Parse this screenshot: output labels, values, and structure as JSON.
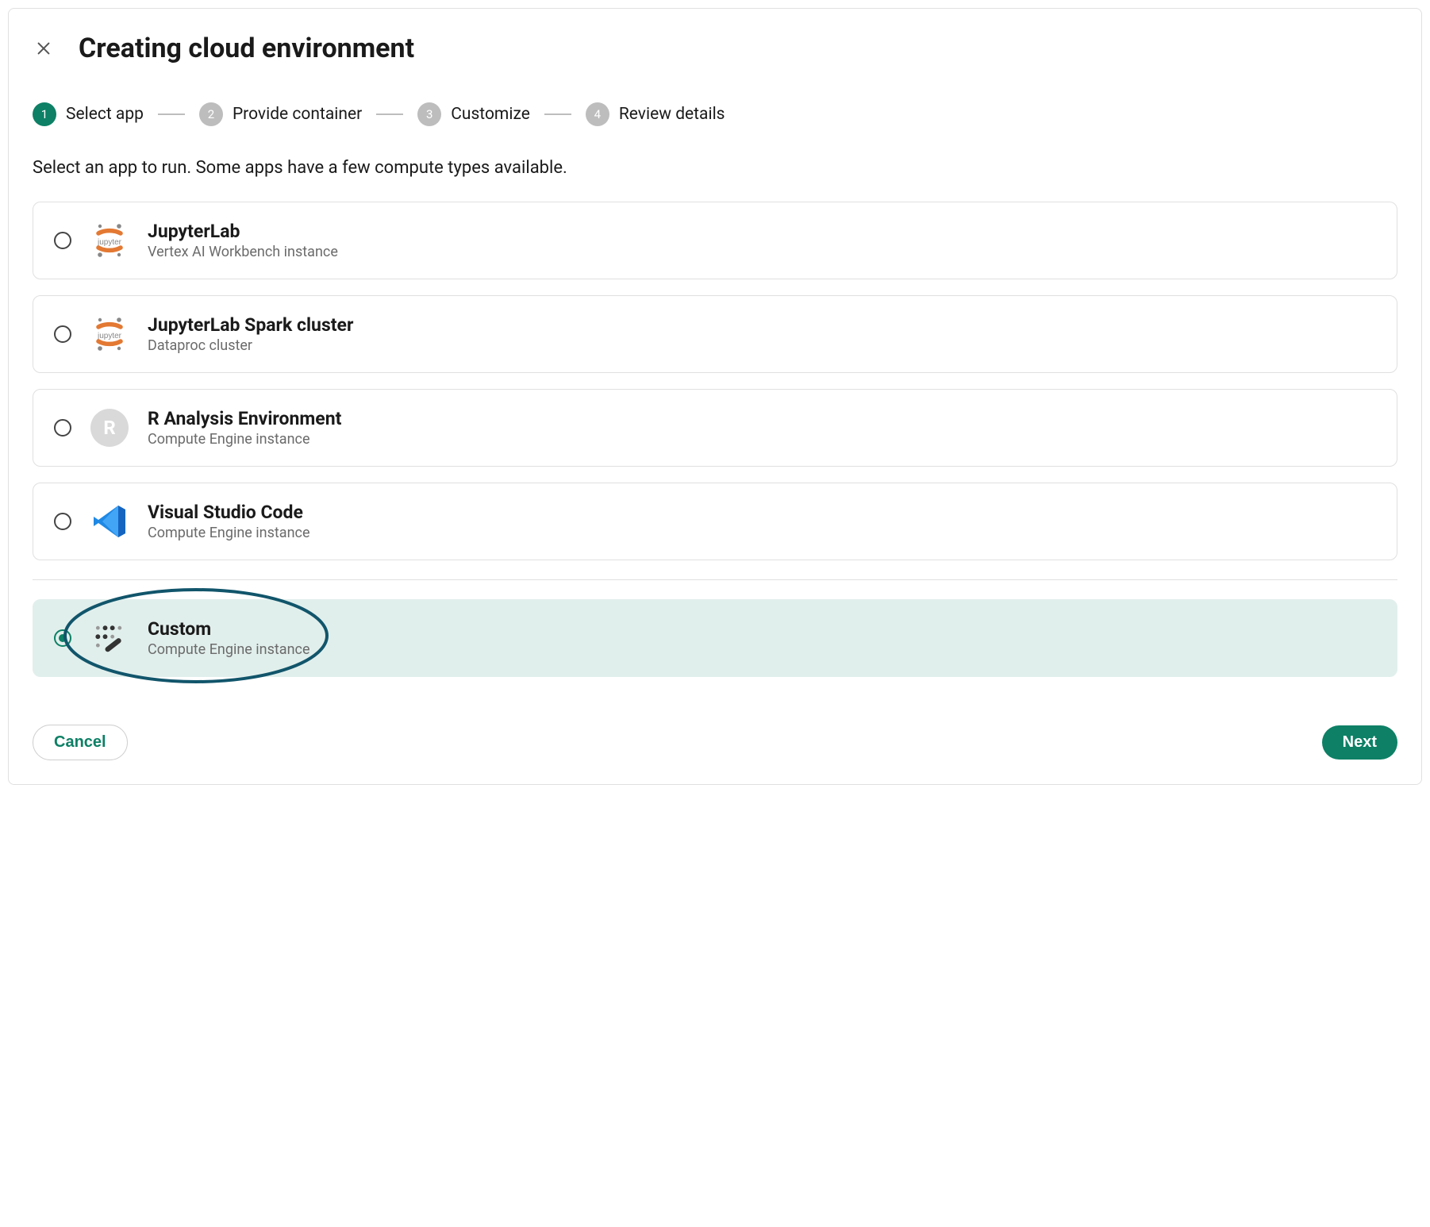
{
  "header": {
    "title": "Creating cloud environment"
  },
  "stepper": {
    "steps": [
      {
        "num": "1",
        "label": "Select app",
        "active": true
      },
      {
        "num": "2",
        "label": "Provide container",
        "active": false
      },
      {
        "num": "3",
        "label": "Customize",
        "active": false
      },
      {
        "num": "4",
        "label": "Review details",
        "active": false
      }
    ]
  },
  "instruction": "Select an app to run. Some apps have a few compute types available.",
  "options": [
    {
      "id": "jupyterlab",
      "title": "JupyterLab",
      "subtitle": "Vertex AI Workbench instance",
      "icon": "jupyter-icon",
      "selected": false
    },
    {
      "id": "jupyterlab-spark",
      "title": "JupyterLab Spark cluster",
      "subtitle": "Dataproc cluster",
      "icon": "jupyter-icon",
      "selected": false
    },
    {
      "id": "r-analysis",
      "title": "R Analysis Environment",
      "subtitle": "Compute Engine instance",
      "icon": "r-icon",
      "selected": false
    },
    {
      "id": "vscode",
      "title": "Visual Studio Code",
      "subtitle": "Compute Engine instance",
      "icon": "vscode-icon",
      "selected": false
    },
    {
      "id": "custom",
      "title": "Custom",
      "subtitle": "Compute Engine instance",
      "icon": "custom-icon",
      "selected": true,
      "annotated": true,
      "divider_before": true
    }
  ],
  "footer": {
    "cancel": "Cancel",
    "next": "Next"
  },
  "colors": {
    "accent": "#0d8065",
    "selected_bg": "#e1efec",
    "muted": "#bdbdbd",
    "annotation_stroke": "#11556b"
  },
  "icons": {
    "r_letter": "R"
  }
}
